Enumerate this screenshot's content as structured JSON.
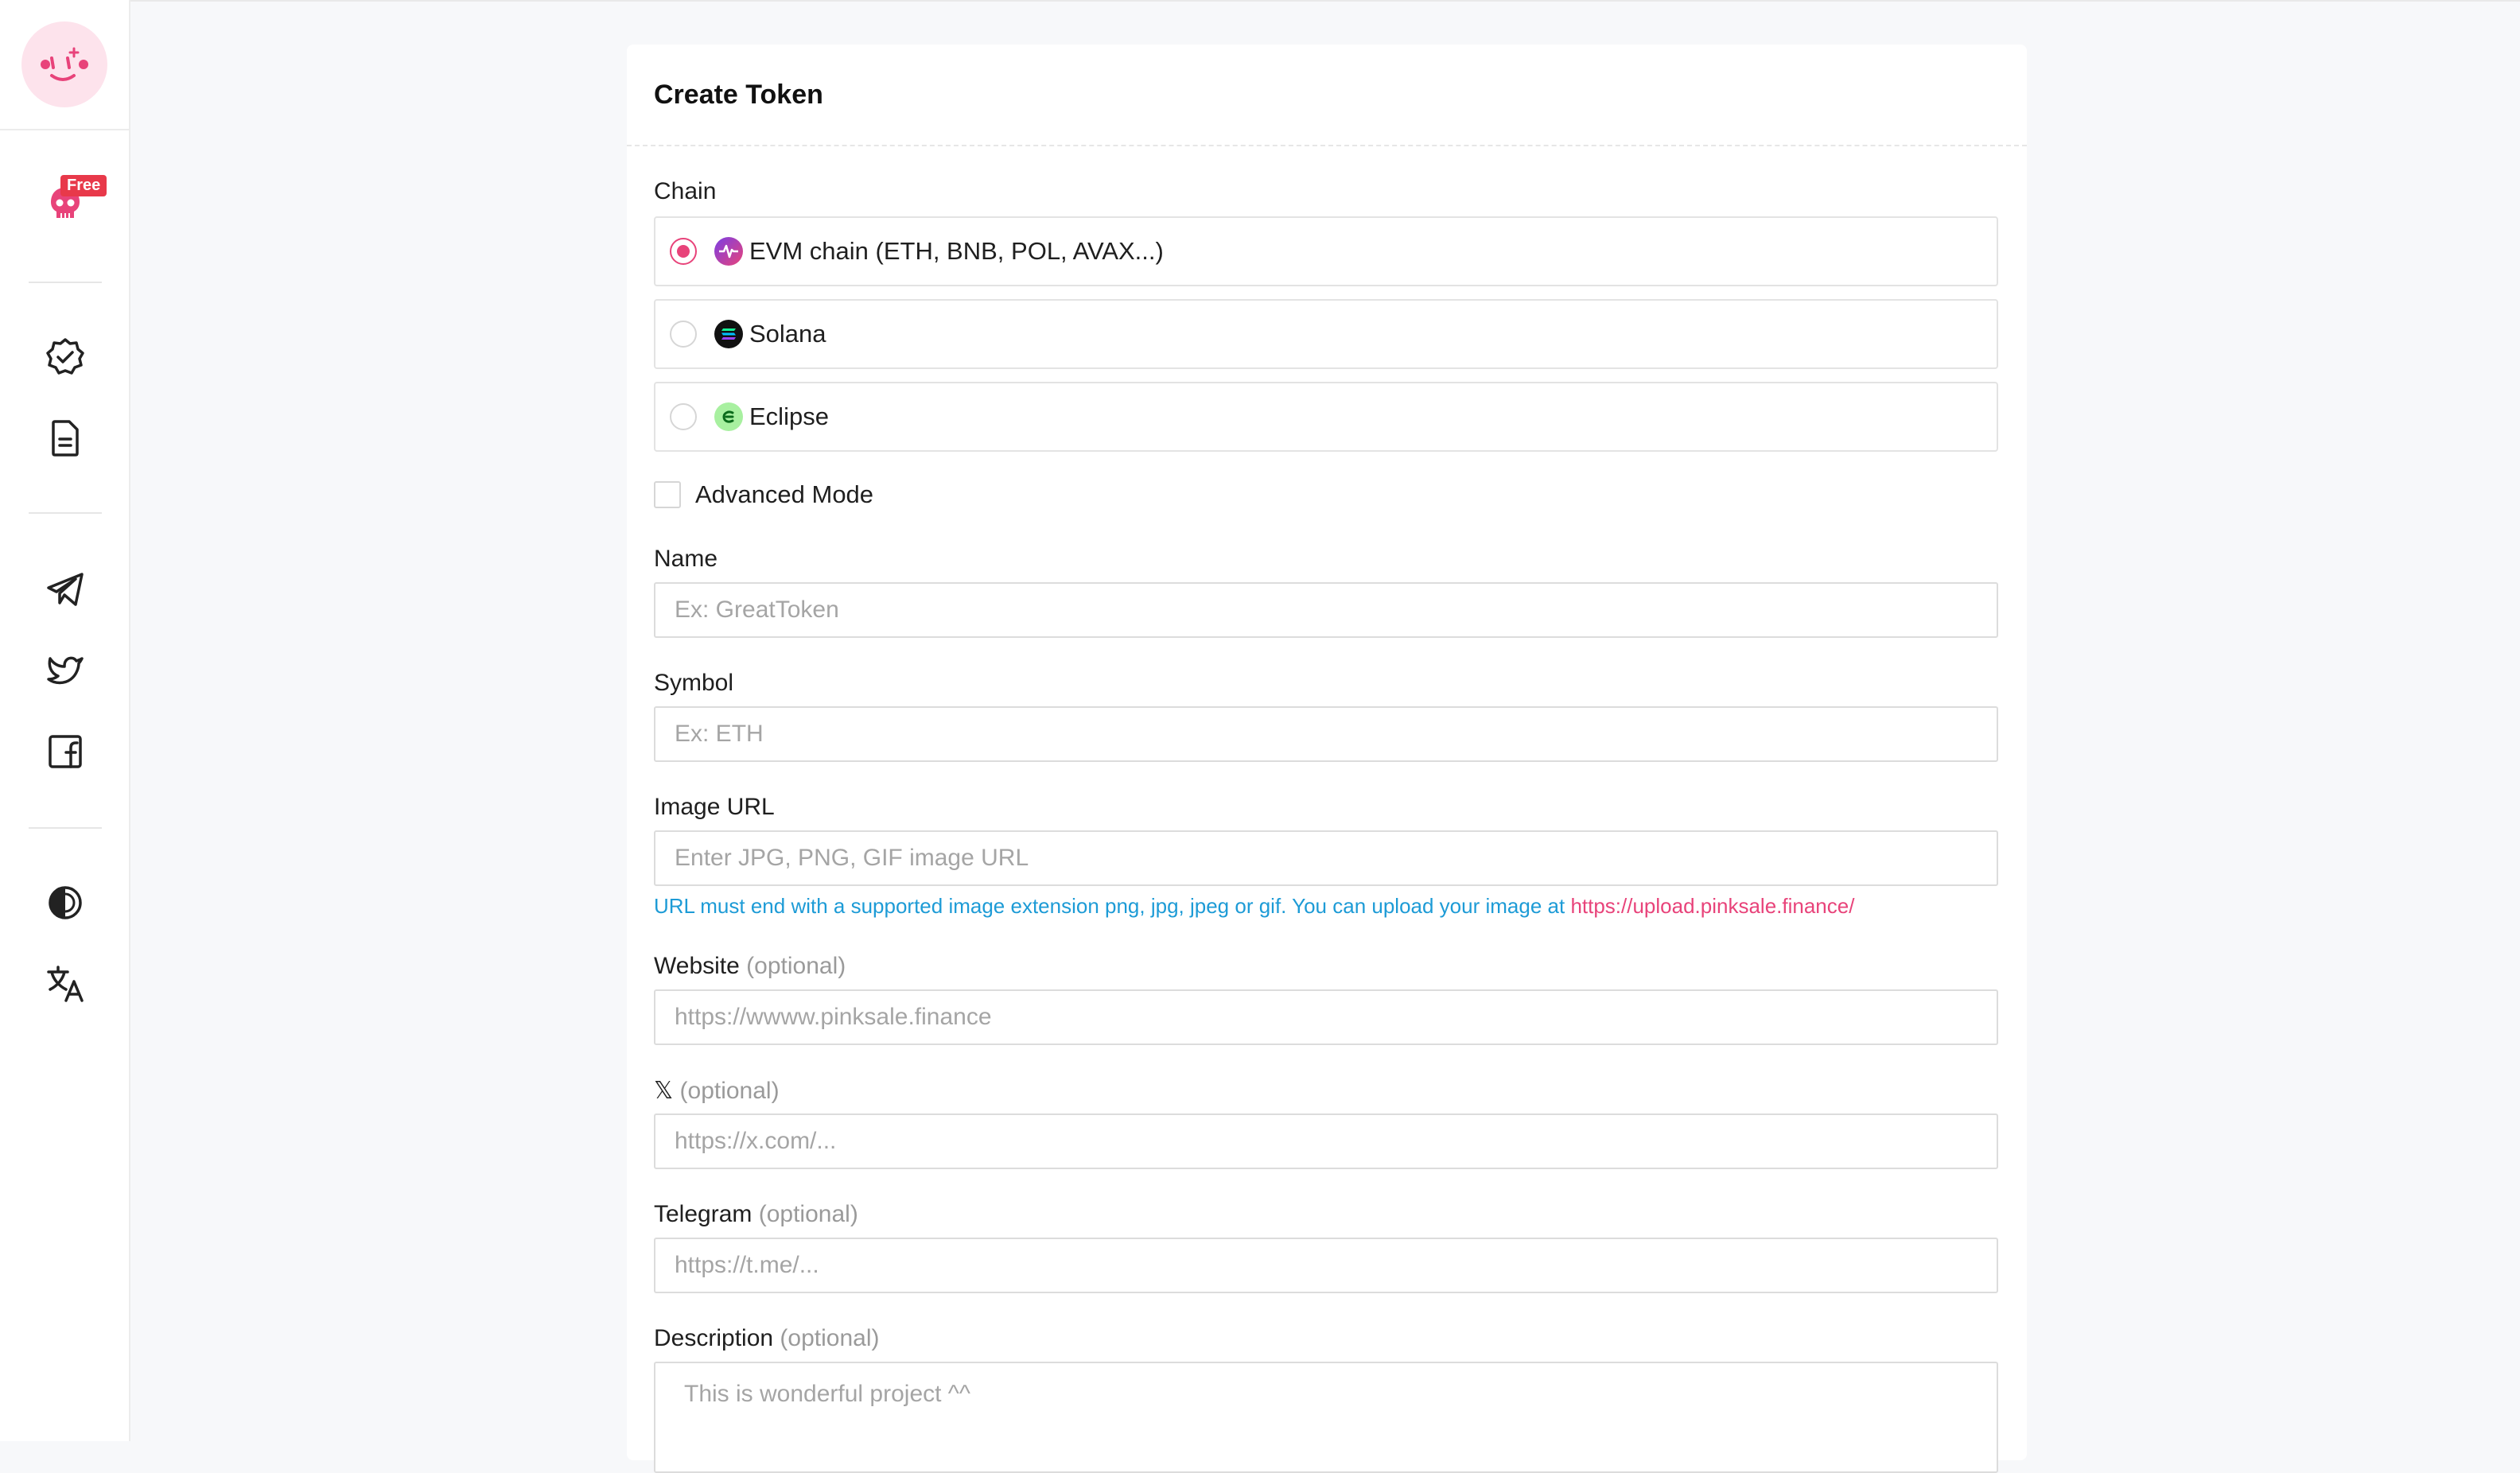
{
  "sidebar": {
    "free_badge": "Free",
    "icons": [
      "mascot-logo-icon",
      "skull-icon",
      "verified-badge-icon",
      "document-icon",
      "telegram-icon",
      "twitter-icon",
      "facebook-icon",
      "theme-contrast-icon",
      "translate-icon"
    ]
  },
  "card": {
    "title": "Create Token"
  },
  "chain": {
    "label": "Chain",
    "options": [
      {
        "label": "EVM chain (ETH, BNB, POL, AVAX...)",
        "selected": true
      },
      {
        "label": "Solana",
        "selected": false
      },
      {
        "label": "Eclipse",
        "selected": false
      }
    ]
  },
  "advanced": {
    "label": "Advanced Mode",
    "checked": false
  },
  "fields": {
    "name": {
      "label": "Name",
      "placeholder": "Ex: GreatToken"
    },
    "symbol": {
      "label": "Symbol",
      "placeholder": "Ex: ETH"
    },
    "image_url": {
      "label": "Image URL",
      "placeholder": "Enter JPG, PNG, GIF image URL",
      "hint": "URL must end with a supported image extension png, jpg, jpeg or gif. You can upload your image at ",
      "hint_link": "https://upload.pinksale.finance/"
    },
    "website": {
      "label": "Website",
      "optional": "(optional)",
      "placeholder": "https://wwww.pinksale.finance"
    },
    "x": {
      "label": "𝕏",
      "optional": "(optional)",
      "placeholder": "https://x.com/..."
    },
    "telegram": {
      "label": "Telegram",
      "optional": "(optional)",
      "placeholder": "https://t.me/..."
    },
    "description": {
      "label": "Description",
      "optional": "(optional)",
      "placeholder": "This is wonderful project ^^"
    }
  },
  "colors": {
    "accent": "#e8437a",
    "hint": "#1d9bd6",
    "badge": "#e8394a"
  }
}
